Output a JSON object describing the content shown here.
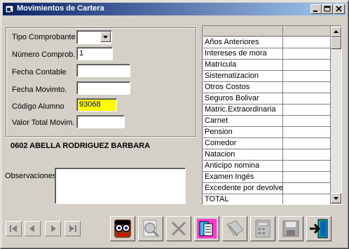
{
  "window": {
    "title": "Movimientos de Cartera",
    "controls": [
      "minimize",
      "maximize",
      "close"
    ]
  },
  "form": {
    "tipo_comprobante": {
      "label": "Tipo Comprobante",
      "value": ""
    },
    "numero_comprob": {
      "label": "Número Comprob.",
      "value": "1"
    },
    "fecha_contable": {
      "label": "Fecha Contable",
      "value": ""
    },
    "fecha_movimto": {
      "label": "Fecha Movimto.",
      "value": ""
    },
    "codigo_alumno": {
      "label": "Código Alumno",
      "value": "93068",
      "highlight_color": "#ffff00"
    },
    "valor_total": {
      "label": "Valor Total Movim.",
      "value": ""
    }
  },
  "student_name": "0602 ABELLA RODRIGUEZ BARBARA",
  "observaciones": {
    "label": "Observaciones",
    "value": ""
  },
  "grid": {
    "rows": [
      {
        "concept": "Años Anteriores",
        "value": ""
      },
      {
        "concept": "Intereses de mora",
        "value": ""
      },
      {
        "concept": "Matrícula",
        "value": ""
      },
      {
        "concept": "Sistematizacion",
        "value": ""
      },
      {
        "concept": "Otros Costos",
        "value": ""
      },
      {
        "concept": "Seguros  Bolivar",
        "value": ""
      },
      {
        "concept": "Matric.Extraordinaria",
        "value": ""
      },
      {
        "concept": "Carnet",
        "value": ""
      },
      {
        "concept": "Pension",
        "value": ""
      },
      {
        "concept": "Comedor",
        "value": ""
      },
      {
        "concept": "Natacion",
        "value": ""
      },
      {
        "concept": "Anticipo nomina",
        "value": ""
      },
      {
        "concept": "Examen Ingés",
        "value": ""
      },
      {
        "concept": "Excedente por devolver",
        "value": ""
      },
      {
        "concept": "TOTAL",
        "value": ""
      }
    ]
  },
  "navigation": [
    "first-record",
    "previous-record",
    "next-record",
    "last-record"
  ],
  "toolbar": [
    "search-student",
    "preview",
    "cancel",
    "new-document",
    "edit",
    "calculator",
    "save",
    "exit"
  ],
  "colors": {
    "titlebar_start": "#0a246a",
    "titlebar_end": "#a6caf0",
    "face": "#d4d0c8",
    "highlight_field": "#ffff00"
  }
}
